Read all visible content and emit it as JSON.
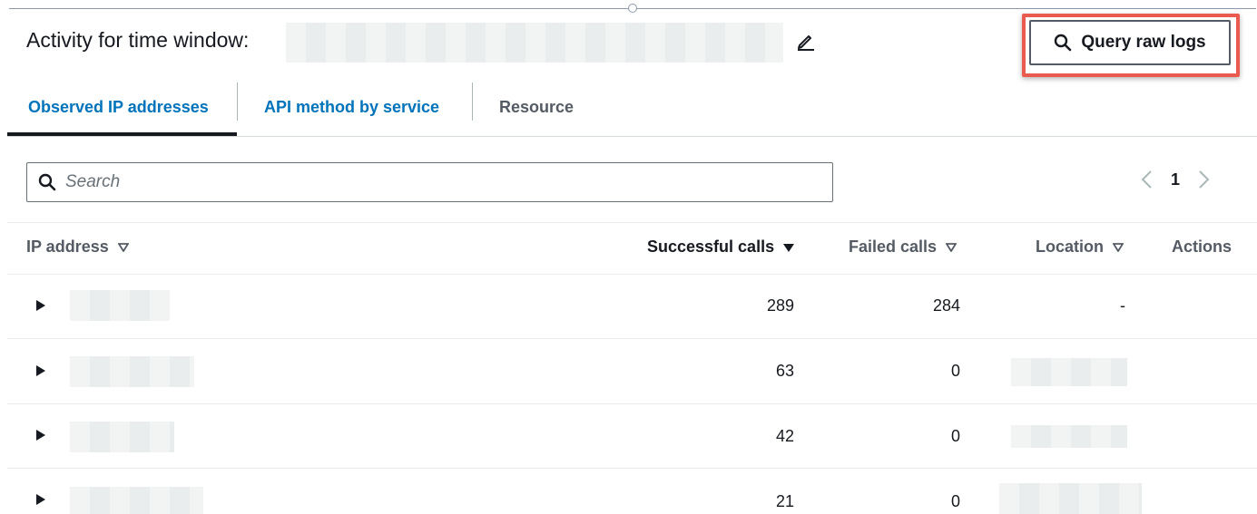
{
  "header": {
    "title": "Activity for time window:",
    "query_button_label": "Query raw logs"
  },
  "tabs": [
    {
      "label": "Observed IP addresses",
      "active": true
    },
    {
      "label": "API method by service",
      "active": false
    },
    {
      "label": "Resource",
      "active": false
    }
  ],
  "search": {
    "placeholder": "Search"
  },
  "pagination": {
    "current_page": "1"
  },
  "table": {
    "columns": {
      "ip": "IP address",
      "successful": "Successful calls",
      "failed": "Failed calls",
      "location": "Location",
      "actions": "Actions"
    },
    "rows": [
      {
        "successful": "289",
        "failed": "284",
        "location": "-"
      },
      {
        "successful": "63",
        "failed": "0",
        "location": ""
      },
      {
        "successful": "42",
        "failed": "0",
        "location": ""
      },
      {
        "successful": "21",
        "failed": "0",
        "location": ""
      }
    ]
  },
  "colors": {
    "accent": "#0073bb",
    "highlight": "#ea5a4f",
    "text": "#16191f",
    "muted": "#545b64"
  },
  "icons": [
    "edit-icon",
    "search-icon",
    "chevron-left-icon",
    "chevron-right-icon",
    "sort-icon",
    "expand-caret-icon"
  ]
}
